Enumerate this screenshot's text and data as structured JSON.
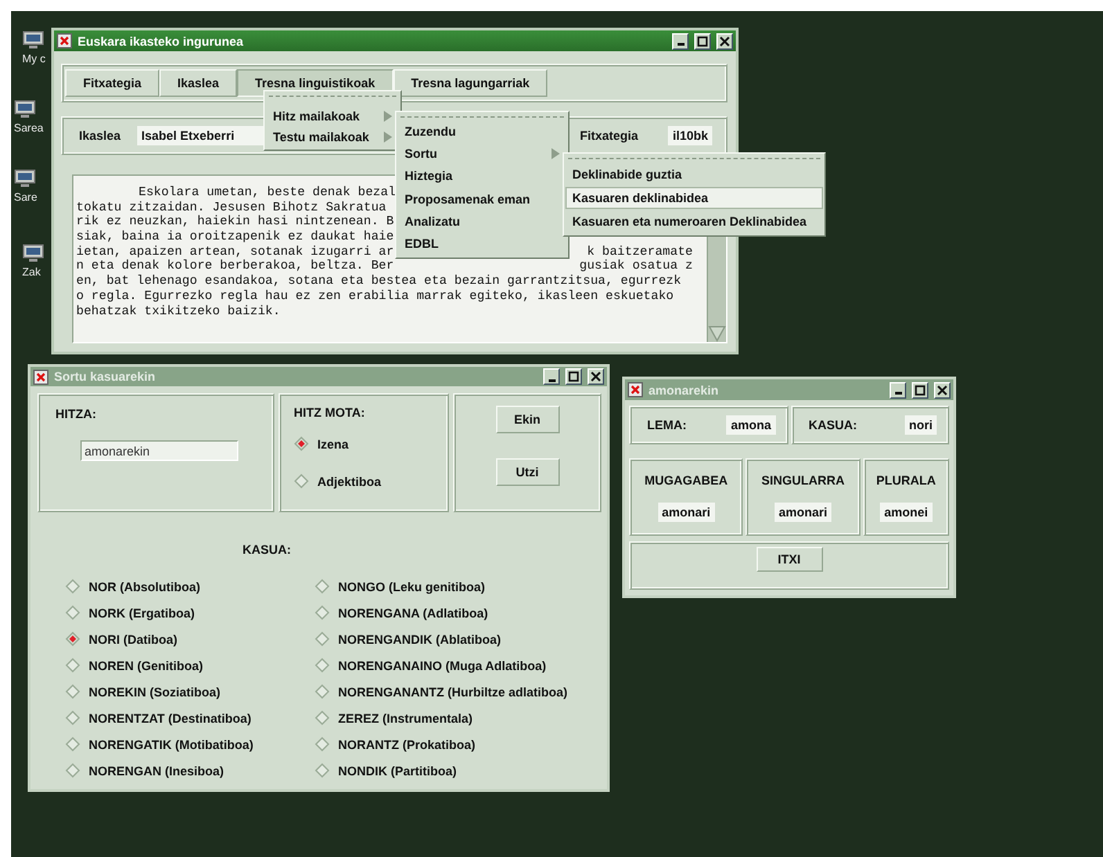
{
  "desktop_icons": [
    {
      "label": "My c"
    },
    {
      "label": "Sarea"
    },
    {
      "label": "Sare"
    },
    {
      "label": "Zak"
    }
  ],
  "main_window": {
    "title": "Euskara ikasteko ingurunea",
    "active": true,
    "menu_buttons": [
      {
        "label": "Fitxategia",
        "selected": false
      },
      {
        "label": "Ikaslea",
        "selected": false
      },
      {
        "label": "Tresna linguistikoak",
        "selected": true
      },
      {
        "label": "Tresna lagungarriak",
        "selected": false
      }
    ],
    "student_label": "Ikaslea",
    "student_value": "Isabel Etxeberri",
    "file_label": "Fitxategia",
    "file_value": "il10bk",
    "text_lines": [
      {
        "left": "Eskolara umetan, beste denak bezal",
        "indent": true
      },
      {
        "left": "tokatu zitzaidan. Jesusen Bihotz Sakratua",
        "indent": false
      },
      {
        "left": "rik ez neuzkan, haiekin hasi nintzenean. B",
        "indent": false
      },
      {
        "left": "siak, baina ia oroitzapenik ez daukat haie",
        "indent": false
      },
      {
        "left": "ietan, apaizen artean, sotanak izugarri ar",
        "right": "k baitzeramate",
        "indent": false
      },
      {
        "left": "n eta denak kolore berberakoa, beltza. Ber",
        "right": "gusiak osatua z",
        "indent": false
      },
      {
        "left": "en, bat lehenago esandakoa, sotana eta bestea eta bezain garrantzitsua, egurrezk",
        "indent": false
      },
      {
        "left": "o regla. Egurrezko regla hau ez zen erabilia marrak egiteko, ikasleen eskuetako",
        "indent": false
      },
      {
        "left": "behatzak txikitzeko baizik.",
        "indent": false
      }
    ]
  },
  "menu": {
    "items": [
      {
        "label": "Hitz mailakoak",
        "submenu": true
      },
      {
        "label": "Testu mailakoak",
        "submenu": true
      }
    ]
  },
  "submenu": {
    "items": [
      {
        "label": "Zuzendu",
        "submenu": false
      },
      {
        "label": "Sortu",
        "submenu": true
      },
      {
        "label": "Hiztegia",
        "submenu": false
      },
      {
        "label": "Proposamenak eman",
        "submenu": false
      },
      {
        "label": "Analizatu",
        "submenu": false
      },
      {
        "label": "EDBL",
        "submenu": false
      }
    ]
  },
  "submenu_2": {
    "items": [
      {
        "label": "Deklinabide guztia",
        "selected": false
      },
      {
        "label": "Kasuaren deklinabidea",
        "selected": true
      },
      {
        "label": "Kasuaren eta numeroaren Deklinabidea",
        "selected": false
      }
    ]
  },
  "sortu_window": {
    "title": "Sortu kasuarekin",
    "active": false,
    "word_label": "HITZA:",
    "word_value": "amonarekin",
    "type_label": "HITZ MOTA:",
    "types": [
      {
        "label": "Izena",
        "selected": true
      },
      {
        "label": "Adjektiboa",
        "selected": false
      }
    ],
    "buttons": [
      "Ekin",
      "Utzi"
    ],
    "case_label": "KASUA:",
    "cases": [
      {
        "label": "NOR (Absolutiboa)",
        "selected": false
      },
      {
        "label": "NORK (Ergatiboa)",
        "selected": false
      },
      {
        "label": "NORI (Datiboa)",
        "selected": true
      },
      {
        "label": "NOREN (Genitiboa)",
        "selected": false
      },
      {
        "label": "NOREKIN (Soziatiboa)",
        "selected": false
      },
      {
        "label": "NORENTZAT (Destinatiboa)",
        "selected": false
      },
      {
        "label": "NORENGATIK (Motibatiboa)",
        "selected": false
      },
      {
        "label": "NORENGAN (Inesiboa)",
        "selected": false
      },
      {
        "label": "NONGO (Leku genitiboa)",
        "selected": false
      },
      {
        "label": "NORENGANA (Adlatiboa)",
        "selected": false
      },
      {
        "label": "NORENGANDIK (Ablatiboa)",
        "selected": false
      },
      {
        "label": "NORENGANAINO (Muga Adlatiboa)",
        "selected": false
      },
      {
        "label": "NORENGANANTZ (Hurbiltze adlatiboa)",
        "selected": false
      },
      {
        "label": "ZEREZ (Instrumentala)",
        "selected": false
      },
      {
        "label": "NORANTZ (Prokatiboa)",
        "selected": false
      },
      {
        "label": "NONDIK (Partitiboa)",
        "selected": false
      }
    ]
  },
  "result_window": {
    "title": "amonarekin",
    "active": false,
    "lemma_label": "LEMA:",
    "lemma_value": "amona",
    "case_label": "KASUA:",
    "case_value": "nori",
    "forms": [
      {
        "header": "MUGAGABEA",
        "value": "amonari"
      },
      {
        "header": "SINGULARRA",
        "value": "amonari"
      },
      {
        "header": "PLURALA",
        "value": "amonei"
      }
    ],
    "close_button": "ITXI"
  }
}
